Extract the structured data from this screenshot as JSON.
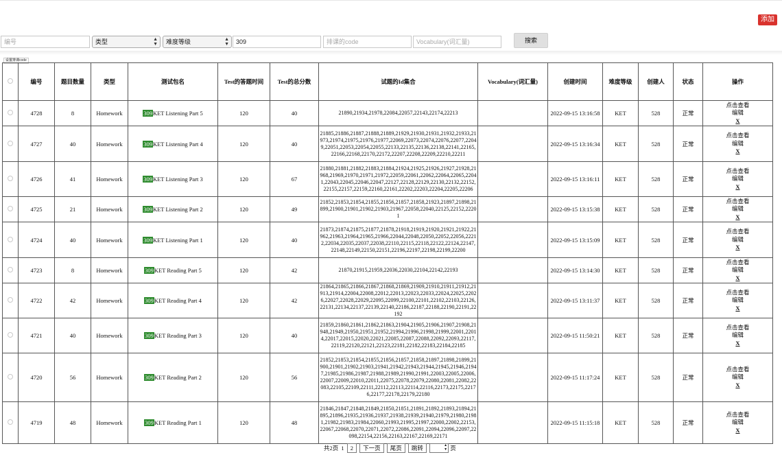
{
  "header": {
    "add_label": "添加"
  },
  "filters": {
    "id_placeholder": "编号",
    "type_select": "类型",
    "difficulty_select": "难度等级",
    "keyword_value": "309",
    "code_placeholder": "排课的code",
    "vocab_placeholder": "Vocabulary(词汇量)",
    "search_label": "搜索"
  },
  "tiny_button_label": "设置排课code",
  "table": {
    "columns": [
      "编号",
      "题目数量",
      "类型",
      "测试包名",
      "Test的答题时间",
      "Test的总分数",
      "试题的Id集合",
      "Vocabulary(词汇量)",
      "创建时间",
      "难度等级",
      "创建人",
      "状态",
      "操作"
    ],
    "actions": {
      "view": "点击查看",
      "edit": "编辑",
      "delete": "X"
    },
    "rows": [
      {
        "id": "4728",
        "count": "8",
        "type": "Homework",
        "name_hl": "309",
        "name": "KET Listening Part 5",
        "time": "120",
        "score": "40",
        "ids": "21890,21934,21978,22084,22057,22143,22174,22213",
        "vocab": "",
        "created": "2022-09-15 13:16:58",
        "level": "KET",
        "creator": "528",
        "status": "正常"
      },
      {
        "id": "4727",
        "count": "40",
        "type": "Homework",
        "name_hl": "309",
        "name": "KET Listening Part 4",
        "time": "120",
        "score": "40",
        "ids": "21885,21886,21887,21888,21889,21929,21930,21931,21932,21933,21973,21974,21975,21976,21977,22069,22073,22074,22076,22077,22049,22051,22053,22054,22055,22133,22135,22136,22138,22141,22165,22166,22168,22170,22172,22207,22208,22209,22210,22211",
        "vocab": "",
        "created": "2022-09-15 13:16:34",
        "level": "KET",
        "creator": "528",
        "status": "正常"
      },
      {
        "id": "4726",
        "count": "41",
        "type": "Homework",
        "name_hl": "309",
        "name": "KET Listening Part 3",
        "time": "120",
        "score": "67",
        "ids": "21880,21881,21882,21883,21884,21924,21925,21926,21927,21928,21968,21969,21970,21971,21972,22059,22061,22062,22064,22065,22041,22043,22045,22046,22047,22127,22128,22129,22130,22132,22152,22155,22157,22159,22160,22161,22202,22203,22204,22205,22206",
        "vocab": "",
        "created": "2022-09-15 13:16:11",
        "level": "KET",
        "creator": "528",
        "status": "正常"
      },
      {
        "id": "4725",
        "count": "21",
        "type": "Homework",
        "name_hl": "309",
        "name": "KET Listening Part 2",
        "time": "120",
        "score": "49",
        "ids": "21852,21853,21854,21855,21856,21857,21858,21923,21897,21898,21899,21900,21901,21902,21903,21967,22058,22040,22125,22152,22201",
        "vocab": "",
        "created": "2022-09-15 13:15:38",
        "level": "KET",
        "creator": "528",
        "status": "正常"
      },
      {
        "id": "4724",
        "count": "40",
        "type": "Homework",
        "name_hl": "309",
        "name": "KET Listening Part 1",
        "time": "120",
        "score": "40",
        "ids": "21873,21874,21875,21877,21878,21918,21919,21920,21921,21922,21962,21963,21964,21965,21966,22044,22048,22050,22052,22056,22212,22034,22035,22037,22038,22110,22115,22118,22122,22124,22147,22148,22149,22150,22151,22196,22197,22198,22199,22200",
        "vocab": "",
        "created": "2022-09-15 13:15:09",
        "level": "KET",
        "creator": "528",
        "status": "正常"
      },
      {
        "id": "4723",
        "count": "8",
        "type": "Homework",
        "name_hl": "309",
        "name": "KET Reading Part 5",
        "time": "120",
        "score": "42",
        "ids": "21870,21915,21959,22036,22030,22104,22142,22193",
        "vocab": "",
        "created": "2022-09-15 13:14:30",
        "level": "KET",
        "creator": "528",
        "status": "正常"
      },
      {
        "id": "4722",
        "count": "42",
        "type": "Homework",
        "name_hl": "309",
        "name": "KET Reading Part 4",
        "time": "120",
        "score": "42",
        "ids": "21864,21865,21866,21867,21868,21869,21909,21910,21911,21912,21913,21914,22004,22008,22012,22013,22023,22033,22024,22025,22026,22027,22028,22029,22095,22099,22100,22101,22102,22103,22126,22131,22134,22137,22139,22140,22186,22187,22188,22190,22191,22192",
        "vocab": "",
        "created": "2022-09-15 13:11:37",
        "level": "KET",
        "creator": "528",
        "status": "正常"
      },
      {
        "id": "4721",
        "count": "40",
        "type": "Homework",
        "name_hl": "309",
        "name": "KET Reading Part 3",
        "time": "120",
        "score": "40",
        "ids": "21859,21860,21861,21862,21863,21904,21905,21906,21907,21908,21948,21949,21950,21951,21952,21994,21996,21998,21999,22001,22014,22017,22015,22020,22021,22085,22087,22088,22092,22093,22117,22119,22120,22121,22123,22181,22182,22183,22184,22185",
        "vocab": "",
        "created": "2022-09-15 11:50:21",
        "level": "KET",
        "creator": "528",
        "status": "正常"
      },
      {
        "id": "4720",
        "count": "56",
        "type": "Homework",
        "name_hl": "309",
        "name": "KET Reading Part 2",
        "time": "120",
        "score": "56",
        "ids": "21852,21853,21854,21855,21856,21857,21858,21897,21898,21899,21900,21901,21902,21903,21941,21942,21943,21944,21945,21946,21947,21985,21986,21987,21988,21989,21990,21991,22003,22005,22006,22007,22009,22010,22011,22075,22078,22079,22080,22081,22082,22083,22105,22109,22111,22112,22113,22114,22116,22173,22175,22176,22177,22178,22179,22180",
        "vocab": "",
        "created": "2022-09-15 11:17:24",
        "level": "KET",
        "creator": "528",
        "status": "正常"
      },
      {
        "id": "4719",
        "count": "48",
        "type": "Homework",
        "name_hl": "309",
        "name": "KET Reading Part 1",
        "time": "120",
        "score": "48",
        "ids": "21846,21847,21848,21849,21850,21851,21891,21892,21893,21894,21895,21896,21935,21936,21937,21938,21939,21940,21979,21980,21981,21982,21983,21984,22060,21993,21995,21997,22000,22002,22153,22067,22068,22070,22071,22072,22086,22091,22094,22096,22097,22098,22154,22156,22163,22167,22169,22171",
        "vocab": "",
        "created": "2022-09-15 11:15:18",
        "level": "KET",
        "creator": "528",
        "status": "正常"
      }
    ]
  },
  "pager": {
    "total_pages": "共2页",
    "page_1": "1",
    "page_2": "2",
    "next": "下一页",
    "last": "尾页",
    "jump": "跳转",
    "page_suffix": "页"
  }
}
